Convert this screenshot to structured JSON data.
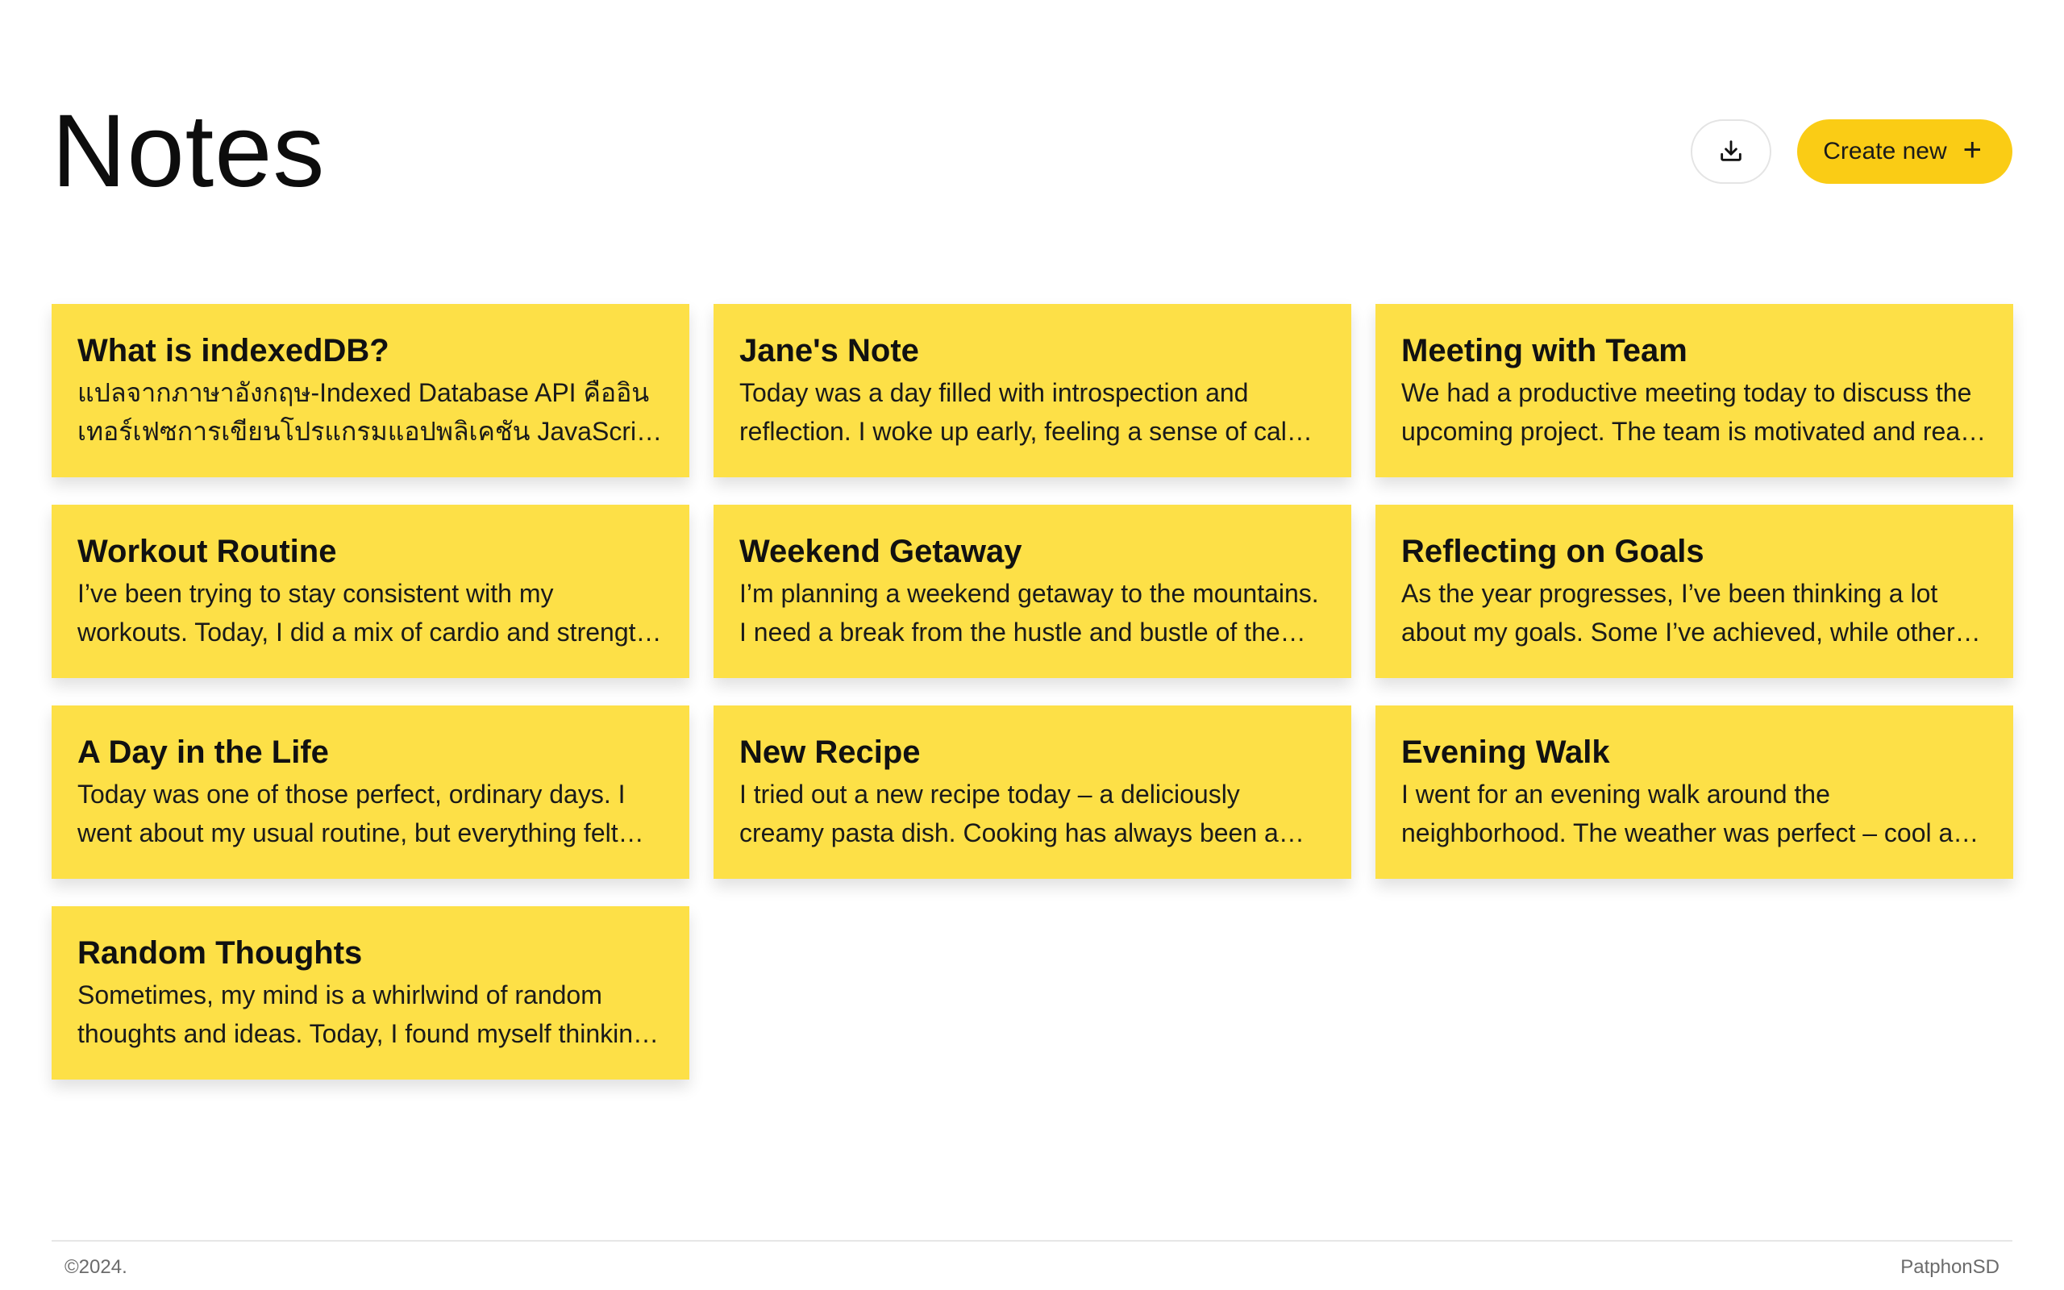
{
  "header": {
    "title": "Notes",
    "export_icon": "download-icon",
    "create_label": "Create new",
    "create_icon": "plus-icon"
  },
  "colors": {
    "card": "#fde047",
    "accent": "#facc15"
  },
  "notes": [
    {
      "title": "What is indexedDB?",
      "body": "แปลจากภาษาอังกฤษ-Indexed Database API คืออินเทอร์เฟซการเขียนโปรแกรมแอปพลิเคชัน JavaScript ที่ใช้จัดเก็บข้อมูล"
    },
    {
      "title": "Jane's Note",
      "body": "Today was a day filled with introspection and reflection. I woke up early, feeling a sense of calm and clarity."
    },
    {
      "title": "Meeting with Team",
      "body": "We had a productive meeting today to discuss the upcoming project. The team is motivated and ready to begin."
    },
    {
      "title": "Workout Routine",
      "body": "I’ve been trying to stay consistent with my workouts. Today, I did a mix of cardio and strength training."
    },
    {
      "title": "Weekend Getaway",
      "body": "I’m planning a weekend getaway to the mountains. I need a break from the hustle and bustle of the city."
    },
    {
      "title": "Reflecting on Goals",
      "body": "As the year progresses, I’ve been thinking a lot about my goals. Some I’ve achieved, while others still need work."
    },
    {
      "title": "A Day in the Life",
      "body": "Today was one of those perfect, ordinary days. I went about my usual routine, but everything felt just right."
    },
    {
      "title": "New Recipe",
      "body": "I tried out a new recipe today – a deliciously creamy pasta dish. Cooking has always been a way for me to relax."
    },
    {
      "title": "Evening Walk",
      "body": "I went for an evening walk around the neighborhood. The weather was perfect – cool and breezy with a clear sky."
    },
    {
      "title": "Random Thoughts",
      "body": "Sometimes, my mind is a whirlwind of random thoughts and ideas. Today, I found myself thinking about many things."
    }
  ],
  "footer": {
    "copyright": "©2024.",
    "author": "PatphonSD"
  }
}
